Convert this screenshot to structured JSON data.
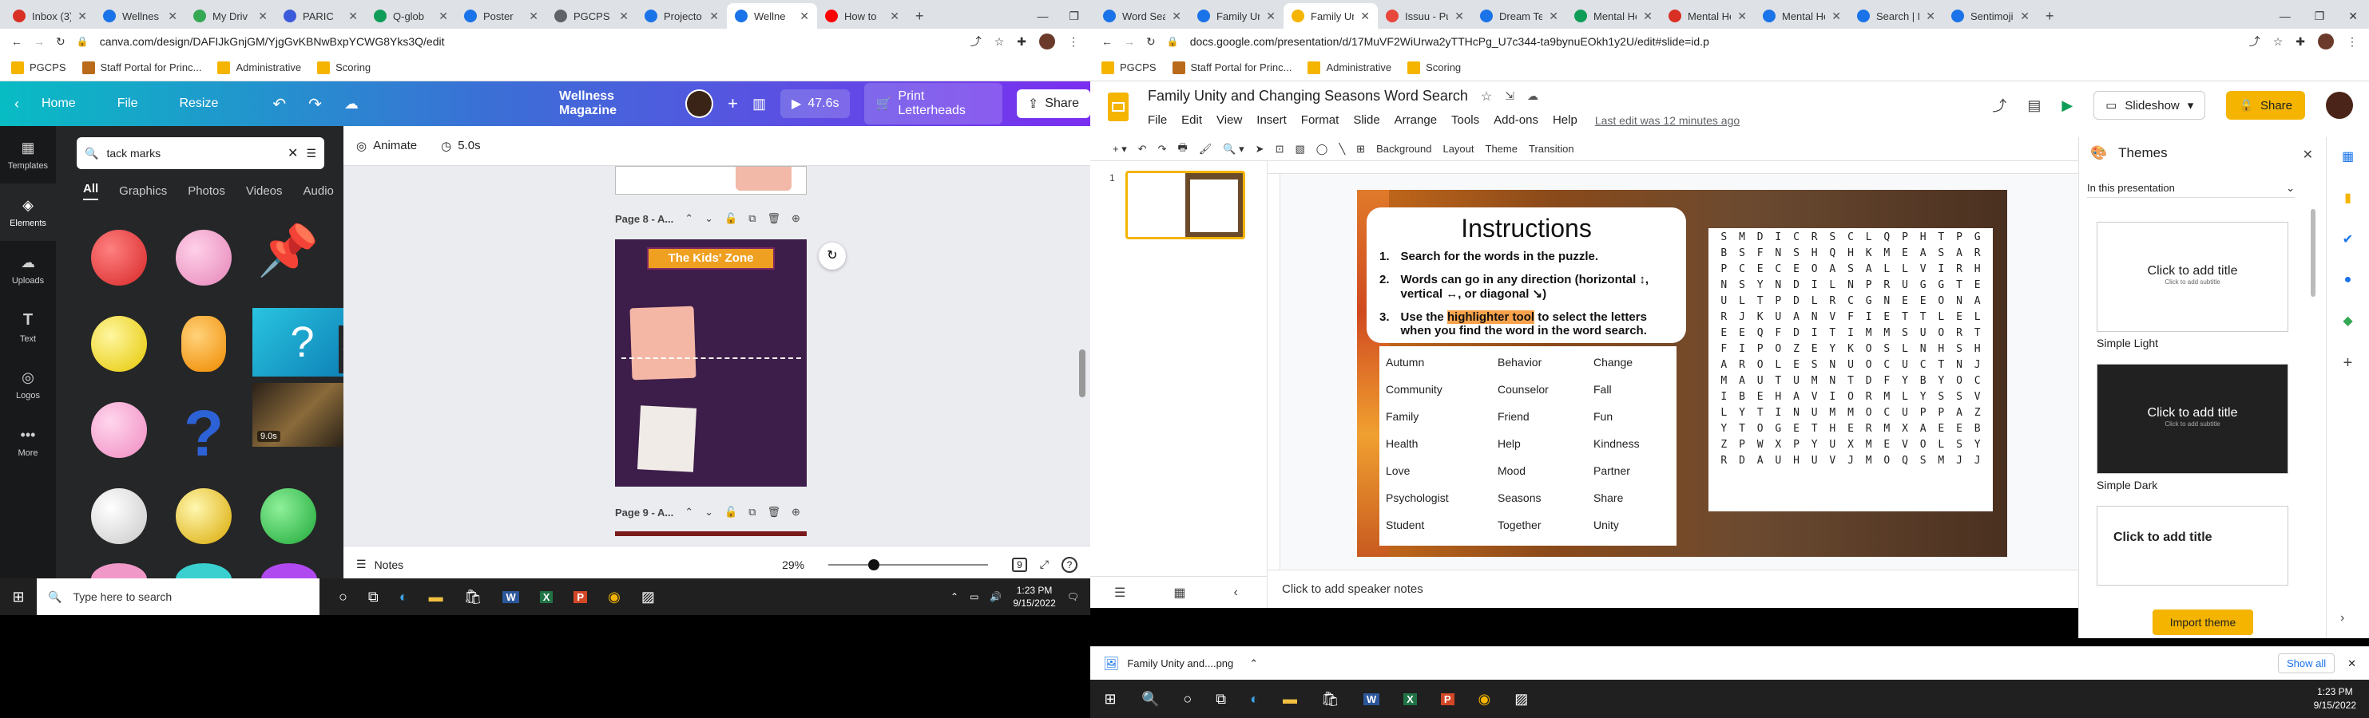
{
  "canva_tabs": [
    {
      "label": "Inbox (3)",
      "color": "#d93025"
    },
    {
      "label": "Wellnes",
      "color": "#1a73e8"
    },
    {
      "label": "My Driv",
      "color": "#34a853"
    },
    {
      "label": "PARIC",
      "color": "#3b5bdb"
    },
    {
      "label": "Q-glob",
      "color": "#0f9d58"
    },
    {
      "label": "Poster",
      "color": "#1a73e8"
    },
    {
      "label": "PGCPS",
      "color": "#5f6368"
    },
    {
      "label": "Projecto",
      "color": "#1a73e8"
    },
    {
      "label": "Wellne",
      "color": "#1a73e8",
      "active": true
    },
    {
      "label": "How to",
      "color": "#ff0000"
    }
  ],
  "slides_tabs": [
    {
      "label": "Word Search",
      "color": "#1a73e8"
    },
    {
      "label": "Family Unit",
      "color": "#1a73e8"
    },
    {
      "label": "Family Unity",
      "color": "#f4b400",
      "active": true
    },
    {
      "label": "Issuu - Publi",
      "color": "#e8473b"
    },
    {
      "label": "Dream Team",
      "color": "#1a73e8"
    },
    {
      "label": "Mental Heal",
      "color": "#0f9d58"
    },
    {
      "label": "Mental Heal",
      "color": "#d93025"
    },
    {
      "label": "Mental Heal",
      "color": "#1a73e8"
    },
    {
      "label": "Search | NAI",
      "color": "#1a73e8"
    },
    {
      "label": "Sentimoji™",
      "color": "#1a73e8"
    }
  ],
  "canva_url": "canva.com/design/DAFIJkGnjGM/YjgGvKBNwBxpYCWG8Yks3Q/edit",
  "slides_url": "docs.google.com/presentation/d/17MuVF2WiUrwa2yTTHcPg_U7c344-ta9bynuEOkh1y2U/edit#slide=id.p",
  "bookmarks": [
    "PGCPS",
    "Staff Portal for Princ...",
    "Administrative",
    "Scoring"
  ],
  "canva": {
    "home": "Home",
    "file": "File",
    "resize": "Resize",
    "title": "Wellness Magazine",
    "duration_btn": "47.6s",
    "print": "Print Letterheads",
    "share": "Share",
    "side": [
      "Templates",
      "Elements",
      "Uploads",
      "Text",
      "Logos",
      "More"
    ],
    "search_value": "tack marks",
    "filters": [
      "All",
      "Graphics",
      "Photos",
      "Videos",
      "Audio"
    ],
    "video_badge": "9.0s",
    "animate": "Animate",
    "time": "5.0s",
    "page8": "Page 8 - A...",
    "page9": "Page 9 - A...",
    "kids_zone": "The Kids' Zone",
    "notes": "Notes",
    "zoom": "29%",
    "page_count": "9"
  },
  "taskbar_left": {
    "search": "Type here to search",
    "time": "1:23 PM",
    "date": "9/15/2022"
  },
  "taskbar_right": {
    "time": "1:23 PM",
    "date": "9/15/2022"
  },
  "slides": {
    "title": "Family Unity and Changing Seasons Word Search",
    "menu": [
      "File",
      "Edit",
      "View",
      "Insert",
      "Format",
      "Slide",
      "Arrange",
      "Tools",
      "Add-ons",
      "Help"
    ],
    "last_edit": "Last edit was 12 minutes ago",
    "slideshow": "Slideshow",
    "share": "Share",
    "tb_background": "Background",
    "tb_layout": "Layout",
    "tb_theme": "Theme",
    "tb_transition": "Transition",
    "speaker_notes": "Click to add speaker notes",
    "slide_num": "1",
    "instructions_title": "Instructions",
    "steps": [
      {
        "num": "1.",
        "text": "Search for the words in the puzzle."
      },
      {
        "num": "2.",
        "text": "Words can go in any direction (horizontal ↕, vertical ↔, or diagonal ↘)"
      },
      {
        "num": "3.",
        "pre": "Use the ",
        "hl": "highlighter tool",
        "post": " to select the letters when you find the word in the word search."
      }
    ],
    "words": [
      "Autumn",
      "Behavior",
      "Change",
      "Community",
      "Counselor",
      "Fall",
      "Family",
      "Friend",
      "Fun",
      "Health",
      "Help",
      "Kindness",
      "Love",
      "Mood",
      "Partner",
      "Psychologist",
      "Seasons",
      "Share",
      "Student",
      "Together",
      "Unity"
    ],
    "grid": [
      "SMDICRSCLQPHTPG",
      "BSFNSHQHKMEASAR",
      "PCECEOASALLVIRH",
      "NSYNDILNPRUGGTE",
      "ULTPDLRCGNEEONA",
      "RJKUANVFIETTLEL",
      "EEQFDITIMMSUORT",
      "FIPOZEYKOSLNHSH",
      "AROLESNUOCUCTNJ",
      "MAUTUMNTDFYBYOC",
      "IBEHAVIORMLYSSV",
      "LYTINUMMOCUPPAZ",
      "YTOGETHERMXAEEB",
      "ZPWXPYUXMEVOLSY",
      "RDAUHUVJMOQSMJJ"
    ]
  },
  "themes": {
    "title": "Themes",
    "filter": "In this presentation",
    "click_title": "Click to add title",
    "click_sub": "Click to add subtitle",
    "light": "Simple Light",
    "dark": "Simple Dark",
    "import": "Import theme"
  },
  "download": {
    "file": "Family Unity and....png",
    "show_all": "Show all"
  }
}
